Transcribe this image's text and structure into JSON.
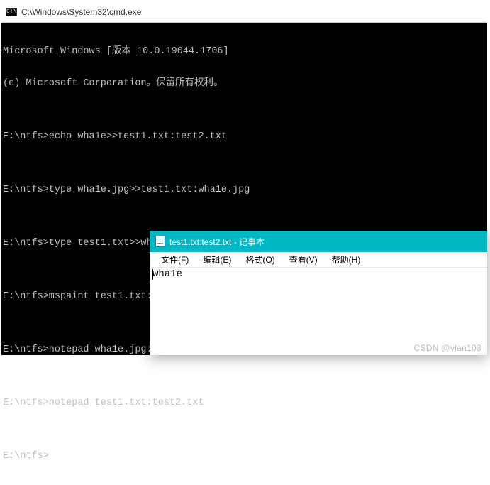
{
  "cmd": {
    "title": "C:\\Windows\\System32\\cmd.exe",
    "lines": [
      "Microsoft Windows [版本 10.0.19044.1706]",
      "(c) Microsoft Corporation。保留所有权利。",
      "",
      "E:\\ntfs>echo wha1e>>test1.txt:test2.txt",
      "",
      "E:\\ntfs>type wha1e.jpg>>test1.txt:wha1e.jpg",
      "",
      "E:\\ntfs>type test1.txt>>wha1e.jpg:test1.txt",
      "",
      "E:\\ntfs>mspaint test1.txt:wha1e.jpg",
      "",
      "E:\\ntfs>notepad wha1e.jpg:test1.txt",
      "",
      "E:\\ntfs>notepad test1.txt:test2.txt",
      "",
      "E:\\ntfs>"
    ]
  },
  "notepad": {
    "title": "test1.txt:test2.txt - 记事本",
    "menus": {
      "file": "文件(F)",
      "edit": "编辑(E)",
      "format": "格式(O)",
      "view": "查看(V)",
      "help": "帮助(H)"
    },
    "content": "wha1e"
  },
  "watermark": "CSDN @vlan103"
}
